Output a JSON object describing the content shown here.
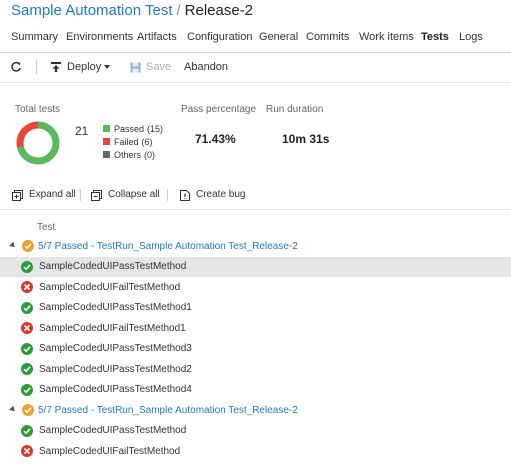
{
  "breadcrumb": {
    "definition": "Sample Automation Test",
    "separator": "/",
    "release": "Release-2"
  },
  "tabs": [
    {
      "label": "Summary",
      "active": false
    },
    {
      "label": "Environments",
      "active": false
    },
    {
      "label": "Artifacts",
      "active": false
    },
    {
      "label": "Configuration",
      "active": false
    },
    {
      "label": "General",
      "active": false
    },
    {
      "label": "Commits",
      "active": false
    },
    {
      "label": "Work items",
      "active": false
    },
    {
      "label": "Tests",
      "active": true
    },
    {
      "label": "Logs",
      "active": false
    }
  ],
  "toolbar": {
    "refresh_icon": "refresh-icon",
    "deploy_label": "Deploy",
    "save_label": "Save",
    "abandon_label": "Abandon"
  },
  "summary": {
    "total_label": "Total tests",
    "total": "21",
    "legend": [
      {
        "label": "Passed",
        "count": "(15)",
        "color": "#5cb85c",
        "value": 15
      },
      {
        "label": "Failed",
        "count": "(6)",
        "color": "#e8453c",
        "value": 6
      },
      {
        "label": "Others",
        "count": "(0)",
        "color": "#666666",
        "value": 0
      }
    ],
    "pass_label": "Pass percentage",
    "pass_value": "71.43%",
    "duration_label": "Run duration",
    "duration_value": "10m 31s"
  },
  "actions": {
    "expand_label": "Expand all",
    "collapse_label": "Collapse all",
    "create_bug_label": "Create bug"
  },
  "columns": {
    "test": "Test"
  },
  "colors": {
    "link": "#1e7ac2",
    "pass": "#2b9b3a",
    "fail": "#d9372a",
    "group_status": "#f0a030",
    "selected": "#e5e5e5"
  },
  "rows": [
    {
      "type": "group",
      "label": "5/7 Passed - TestRun_Sample Automation Test_Release-2"
    },
    {
      "type": "test",
      "status": "pass",
      "label": "SampleCodedUIPassTestMethod",
      "selected": true
    },
    {
      "type": "test",
      "status": "fail",
      "label": "SampleCodedUIFailTestMethod"
    },
    {
      "type": "test",
      "status": "pass",
      "label": "SampleCodedUIPassTestMethod1"
    },
    {
      "type": "test",
      "status": "fail",
      "label": "SampleCodedUIFailTestMethod1"
    },
    {
      "type": "test",
      "status": "pass",
      "label": "SampleCodedUIPassTestMethod3"
    },
    {
      "type": "test",
      "status": "pass",
      "label": "SampleCodedUIPassTestMethod2"
    },
    {
      "type": "test",
      "status": "pass",
      "label": "SampleCodedUIPassTestMethod4"
    },
    {
      "type": "group",
      "label": "5/7 Passed - TestRun_Sample Automation Test_Release-2"
    },
    {
      "type": "test",
      "status": "pass",
      "label": "SampleCodedUIPassTestMethod"
    },
    {
      "type": "test",
      "status": "fail",
      "label": "SampleCodedUIFailTestMethod"
    }
  ]
}
